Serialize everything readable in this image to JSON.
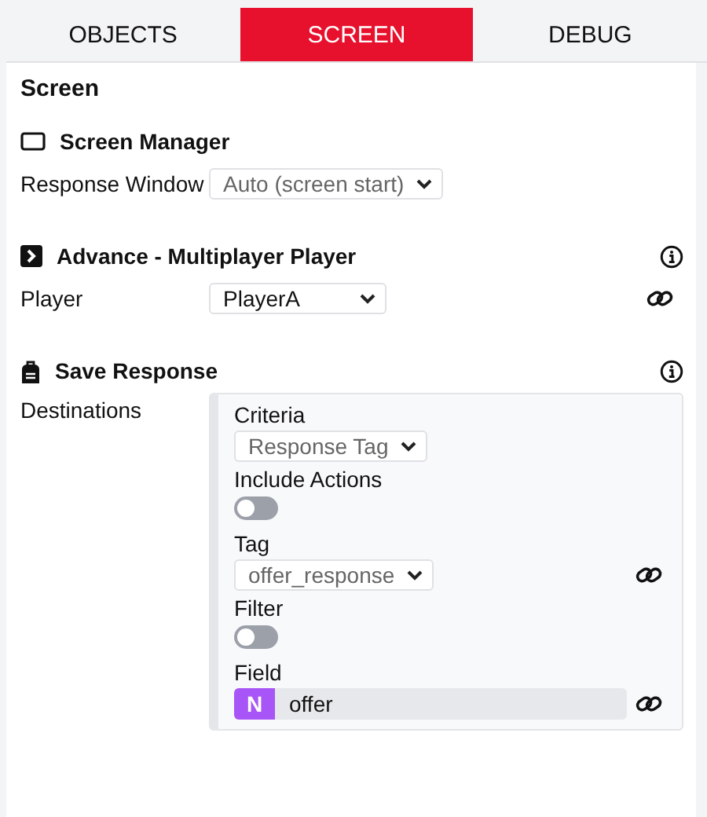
{
  "tabs": [
    {
      "label": "OBJECTS",
      "selected": false
    },
    {
      "label": "SCREEN",
      "selected": true
    },
    {
      "label": "DEBUG",
      "selected": false
    }
  ],
  "title": "Screen",
  "sections": [
    {
      "title": "Screen Manager",
      "info": false,
      "rows": [
        {
          "kind": "select",
          "label": "Response Window",
          "value": "Auto (screen start)",
          "disabled": true,
          "linked": false
        }
      ]
    },
    {
      "title": "Advance - Multiplayer Player",
      "info": true,
      "rows": [
        {
          "kind": "select",
          "label": "Player",
          "value": "PlayerA",
          "disabled": false,
          "linked": true
        }
      ]
    },
    {
      "title": "Save Response",
      "info": true,
      "rows": [
        {
          "kind": "group",
          "label": "Destinations",
          "items": [
            {
              "kind": "select",
              "label": "Criteria",
              "value": "Response Tag",
              "disabled": true,
              "linked": false
            },
            {
              "kind": "toggle",
              "label": "Include Actions",
              "on": false
            },
            {
              "kind": "select",
              "label": "Tag",
              "value": "offer_response",
              "disabled": true,
              "linked": true
            },
            {
              "kind": "toggle",
              "label": "Filter",
              "on": false
            },
            {
              "kind": "field",
              "label": "Field",
              "badge": "N",
              "value": "offer",
              "linked": true
            }
          ]
        }
      ]
    }
  ]
}
